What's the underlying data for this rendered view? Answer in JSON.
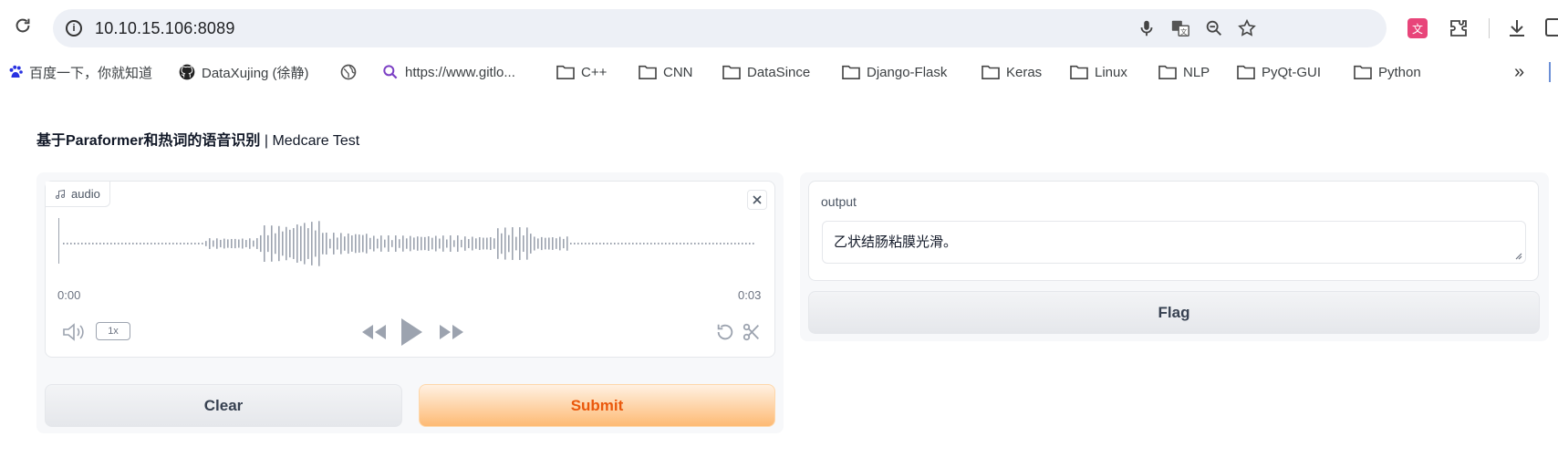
{
  "browser": {
    "url": "10.10.15.106:8089",
    "bookmarks": [
      {
        "label": "百度一下，你就知道",
        "icon": "baidu-icon"
      },
      {
        "label": "DataXujing (徐静)",
        "icon": "github-icon"
      },
      {
        "label": "",
        "icon": "globe-icon"
      },
      {
        "label": "https://www.gitlo...",
        "icon": "search-icon"
      },
      {
        "label": "C++",
        "icon": "folder-icon"
      },
      {
        "label": "CNN",
        "icon": "folder-icon"
      },
      {
        "label": "DataSince",
        "icon": "folder-icon"
      },
      {
        "label": "Django-Flask",
        "icon": "folder-icon"
      },
      {
        "label": "Keras",
        "icon": "folder-icon"
      },
      {
        "label": "Linux",
        "icon": "folder-icon"
      },
      {
        "label": "NLP",
        "icon": "folder-icon"
      },
      {
        "label": "PyQt-GUI",
        "icon": "folder-icon"
      },
      {
        "label": "Python",
        "icon": "folder-icon"
      }
    ],
    "more_label": "»"
  },
  "app": {
    "title_bold": "基于Paraformer和热词的语音识别",
    "title_rest": " | Medcare Test",
    "audio": {
      "label": "audio",
      "time_start": "0:00",
      "time_end": "0:03",
      "speed": "1x"
    },
    "buttons": {
      "clear": "Clear",
      "submit": "Submit",
      "flag": "Flag"
    },
    "output": {
      "label": "output",
      "value": "乙状结肠粘膜光滑。"
    }
  },
  "colors": {
    "accent": "#ea580c",
    "primary_bg": "#fdba74",
    "waveform": "#9ca3af"
  }
}
